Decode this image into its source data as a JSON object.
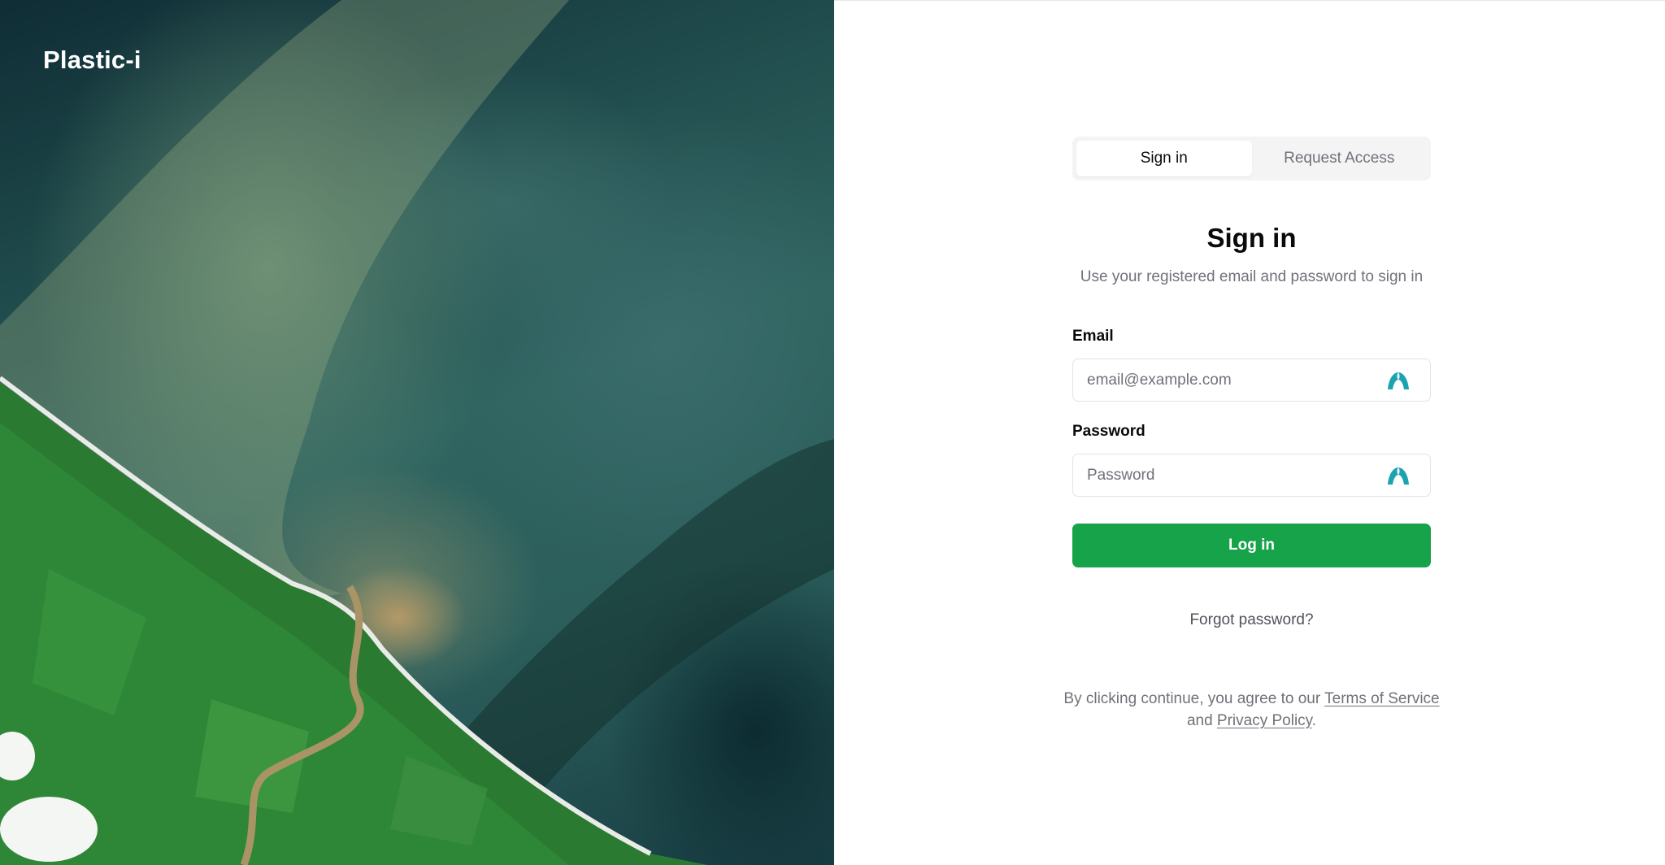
{
  "brand": {
    "name": "Plastic-i"
  },
  "tabs": [
    {
      "label": "Sign in",
      "active": true
    },
    {
      "label": "Request Access",
      "active": false
    }
  ],
  "form": {
    "title": "Sign in",
    "subtitle": "Use your registered email and password to sign in",
    "email": {
      "label": "Email",
      "placeholder": "email@example.com",
      "value": ""
    },
    "password": {
      "label": "Password",
      "placeholder": "Password",
      "value": ""
    },
    "submit_label": "Log in",
    "forgot_label": "Forgot password?"
  },
  "legal": {
    "prefix": "By clicking continue, you agree to our",
    "terms_label": "Terms of Service",
    "middle": "and",
    "privacy_label": "Privacy Policy",
    "suffix": "."
  },
  "colors": {
    "primary_button": "#16a34a",
    "password_manager_icon": "#1ba3b0",
    "muted_text": "#71717a"
  },
  "icons": {
    "field_autofill": "password-manager-icon"
  }
}
